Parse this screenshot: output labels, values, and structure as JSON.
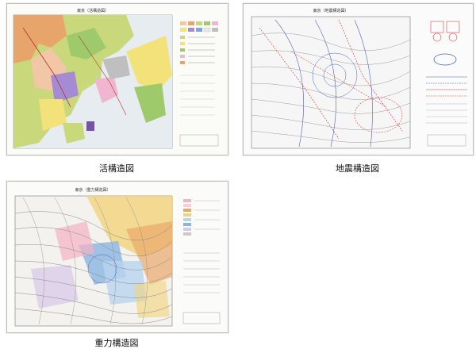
{
  "maps": [
    {
      "id": "active",
      "caption": "活構造図",
      "sheet_title": "東京（活構造図）",
      "palette": [
        "#f2c7a6",
        "#e7a56b",
        "#c8d87a",
        "#9fca6b",
        "#f3e27a",
        "#f0b6cf",
        "#a58bd4",
        "#7fa6d8",
        "#e8e8e8",
        "#bfbfbf"
      ]
    },
    {
      "id": "seismic",
      "caption": "地震構造図",
      "sheet_title": "東京（地震構造図）",
      "palette": [
        "#d24a4a",
        "#4a63b8",
        "#8a8a8a"
      ]
    },
    {
      "id": "gravity",
      "caption": "重力構造図",
      "sheet_title": "東京（重力構造図）",
      "palette": [
        "#8ab4e0",
        "#b8d4ef",
        "#f2d27a",
        "#e9a86b",
        "#f4b2c4",
        "#d6c8e8",
        "#c9c9c9"
      ]
    }
  ]
}
